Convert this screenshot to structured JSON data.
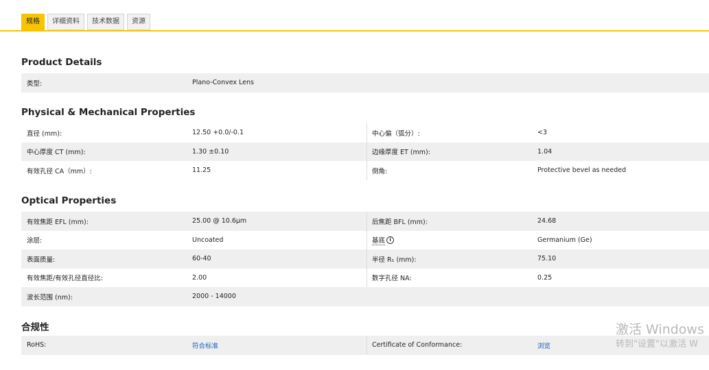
{
  "tabs": [
    {
      "label": "规格",
      "active": true
    },
    {
      "label": "详细资料"
    },
    {
      "label": "技术数据"
    },
    {
      "label": "资源"
    }
  ],
  "product": {
    "title": "Product Details",
    "type_label": "类型:",
    "type_value": "Plano-Convex Lens"
  },
  "physical": {
    "title": "Physical & Mechanical Properties",
    "rows": [
      {
        "l1": "直径 (mm):",
        "v1": "12.50 +0.0/-0.1",
        "l2": "中心偏（弧分）:",
        "v2": "<3"
      },
      {
        "l1": "中心厚度 CT (mm):",
        "v1": "1.30 ±0.10",
        "l2": "边缘厚度 ET (mm):",
        "v2": "1.04"
      },
      {
        "l1": "有效孔径 CA（mm）:",
        "v1": "11.25",
        "l2": "倒角:",
        "v2": "Protective bevel as needed"
      }
    ]
  },
  "optical": {
    "title": "Optical Properties",
    "rows": [
      {
        "l1": "有效焦距 EFL (mm):",
        "v1": "25.00 @ 10.6μm",
        "l2": "后焦距 BFL (mm):",
        "v2": "24.68"
      },
      {
        "l1": "涂层:",
        "v1": "Uncoated",
        "l2": "基底",
        "v2": "Germanium (Ge)"
      },
      {
        "l1": "表面质量:",
        "v1": "60-40",
        "l2": "半径 R₁ (mm):",
        "v2": "75.10"
      },
      {
        "l1": "有效焦距/有效孔径直径比:",
        "v1": "2.00",
        "l2": "数字孔径 NA:",
        "v2": "0.25"
      },
      {
        "l1": "波长范围 (nm):",
        "v1": "2000 - 14000"
      }
    ]
  },
  "compliance": {
    "title": "合规性",
    "rohs_label": "RoHS:",
    "rohs_value": "符合标准",
    "coc_label": "Certificate of Conformance:",
    "coc_value": "浏览"
  },
  "watermark": {
    "line1": "激活 Windows",
    "line2": "转到\"设置\"以激活 W"
  },
  "colors": {
    "accent": "#f6c400",
    "link": "#1a5fb4",
    "row_shade": "#efefef"
  }
}
